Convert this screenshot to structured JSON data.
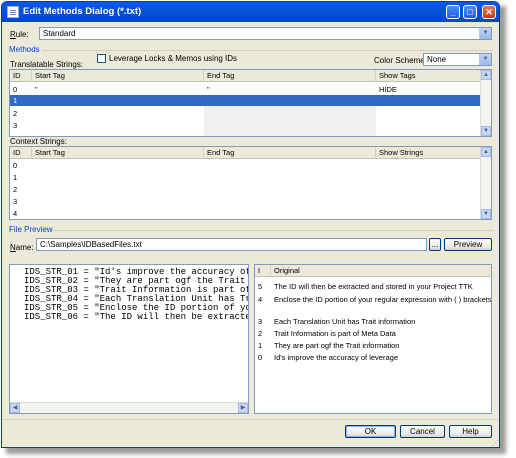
{
  "window": {
    "title": "Edit Methods Dialog (*.txt)",
    "controls": {
      "minimize": "_",
      "maximize": "□",
      "close": "✕"
    }
  },
  "rule": {
    "label_u": "R",
    "label_rest": "ule:",
    "value": "Standard"
  },
  "methods": {
    "group_title": "Methods",
    "translatable_label": "Translatable Strings:",
    "leverage_label": "Leverage Locks & Memos using IDs",
    "color_scheme_label": "Color Scheme:",
    "color_scheme_value": "None",
    "translatable_grid": {
      "headers": [
        "ID",
        "Start Tag",
        "End Tag",
        "Show Tags"
      ],
      "rows": [
        [
          "0",
          "\"",
          "\"",
          "HIDE"
        ],
        [
          "1",
          "",
          "",
          ""
        ],
        [
          "2",
          "",
          "",
          ""
        ],
        [
          "3",
          "",
          "",
          ""
        ]
      ]
    },
    "context_label": "Context Strings:",
    "context_grid": {
      "headers": [
        "ID",
        "Start Tag",
        "End Tag",
        "Show Strings"
      ],
      "rows": [
        [
          "0",
          "",
          "",
          ""
        ],
        [
          "1",
          "",
          "",
          ""
        ],
        [
          "2",
          "",
          "",
          ""
        ],
        [
          "3",
          "",
          "",
          ""
        ],
        [
          "4",
          "",
          "",
          ""
        ]
      ]
    }
  },
  "file_preview": {
    "group_title": "File Preview",
    "name_label_u": "N",
    "name_label_rest": "ame:",
    "file_path": "C:\\Samples\\IDBasedFiles.txt",
    "browse_label": "...",
    "preview_label": "Preview",
    "source_lines": [
      "IDS_STR_01 = \"Id's improve the accuracy of",
      "IDS_STR_02 = \"They are part ogf the Trait i",
      "IDS_STR_03 = \"Trait Information is part of",
      "IDS_STR_04 = \"Each Translation Unit has Tra",
      "IDS_STR_05 = \"Enclose the ID portion of you",
      "IDS_STR_06 = \"The ID will then be extracted"
    ],
    "result_headers": [
      "I",
      "Original"
    ],
    "result_rows": [
      {
        "id": "5",
        "text": "The ID will then be extracted and stored in your Project TTK"
      },
      {
        "id": "4",
        "text": "Enclose the ID portion of your regular expression with ( ) brackets"
      },
      {
        "id": "",
        "text": ""
      },
      {
        "id": "3",
        "text": "Each Translation Unit has Trait information"
      },
      {
        "id": "2",
        "text": "Trait Information is part of Meta Data"
      },
      {
        "id": "1",
        "text": "They are part ogf the Trait information"
      },
      {
        "id": "0",
        "text": "Id's improve the accuracy of leverage"
      }
    ]
  },
  "footer": {
    "ok": "OK",
    "cancel": "Cancel",
    "help": "Help"
  }
}
